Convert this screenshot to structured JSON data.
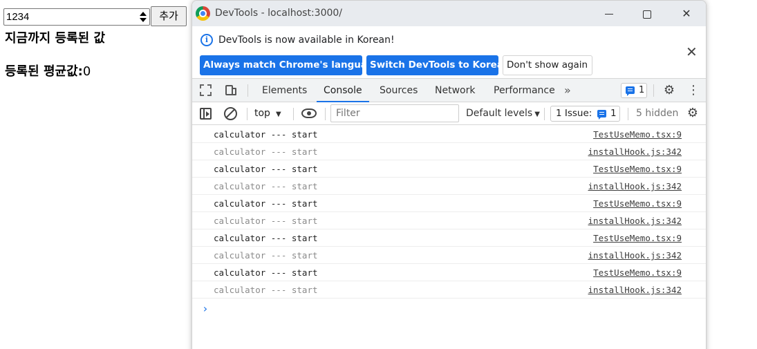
{
  "host": {
    "input_value": "1234",
    "add_button": "추가",
    "heading": "지금까지 등록된 값",
    "average_label": "등록된 평균값:",
    "average_value": "0"
  },
  "devtools": {
    "window_title": "DevTools - localhost:3000/",
    "infobar": {
      "message": "DevTools is now available in Korean!",
      "buttons": [
        "Always match Chrome's language",
        "Switch DevTools to Korean",
        "Don't show again"
      ],
      "close": "✕"
    },
    "tabs": [
      "Elements",
      "Console",
      "Sources",
      "Network",
      "Performance"
    ],
    "active_tab": "Console",
    "more_tabs": "»",
    "issues_badge_count": "1",
    "toolbar": {
      "context": "top",
      "filter_placeholder": "Filter",
      "levels": "Default levels",
      "issues_label": "1 Issue:",
      "issues_count": "1",
      "hidden": "5 hidden"
    },
    "console_rows": [
      {
        "text": "calculator --- start",
        "source": "TestUseMemo.tsx:9",
        "dim": false
      },
      {
        "text": "calculator --- start",
        "source": "installHook.js:342",
        "dim": true
      },
      {
        "text": "calculator --- start",
        "source": "TestUseMemo.tsx:9",
        "dim": false
      },
      {
        "text": "calculator --- start",
        "source": "installHook.js:342",
        "dim": true
      },
      {
        "text": "calculator --- start",
        "source": "TestUseMemo.tsx:9",
        "dim": false
      },
      {
        "text": "calculator --- start",
        "source": "installHook.js:342",
        "dim": true
      },
      {
        "text": "calculator --- start",
        "source": "TestUseMemo.tsx:9",
        "dim": false
      },
      {
        "text": "calculator --- start",
        "source": "installHook.js:342",
        "dim": true
      },
      {
        "text": "calculator --- start",
        "source": "TestUseMemo.tsx:9",
        "dim": false
      },
      {
        "text": "calculator --- start",
        "source": "installHook.js:342",
        "dim": true
      }
    ],
    "prompt": "›",
    "colors": {
      "accent": "#1a73e8",
      "titlebar": "#e8ebef"
    }
  }
}
